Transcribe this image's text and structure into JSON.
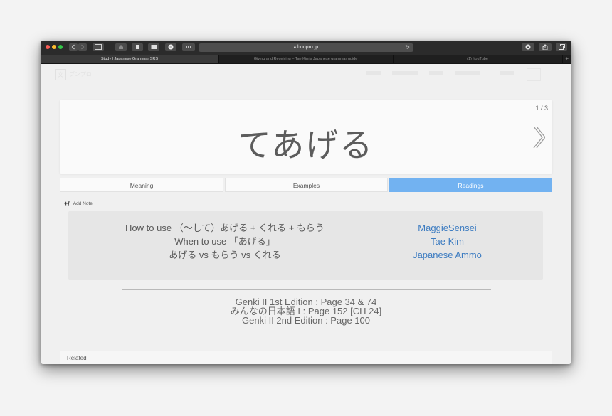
{
  "browser": {
    "url": "bunpro.jp",
    "tabs": [
      {
        "title": "Study | Japanese Grammar SRS",
        "active": true
      },
      {
        "title": "Giving and Receiving – Tae Kim's Japanese grammar guide",
        "active": false
      },
      {
        "title": "(1) YouTube",
        "active": false
      }
    ],
    "icons": [
      "back-icon",
      "forward-icon",
      "sidebar-icon",
      "home-icon",
      "evernote-icon",
      "reader-icon",
      "ublock-icon",
      "more-icon",
      "lock-icon",
      "reload-icon",
      "download-icon",
      "share-icon",
      "tabs-icon",
      "new-tab-icon"
    ]
  },
  "card": {
    "counter": "1 / 3",
    "grammar_point": "てあげる"
  },
  "tabs": [
    {
      "label": "Meaning",
      "active": false
    },
    {
      "label": "Examples",
      "active": false
    },
    {
      "label": "Readings",
      "active": true
    }
  ],
  "add_note": "Add Note",
  "readings": [
    {
      "label": "How to use （〜して）あげる + くれる + もらう",
      "source": "MaggieSensei"
    },
    {
      "label": "When to use 「あげる」",
      "source": "Tae Kim"
    },
    {
      "label": "あげる vs もらう vs くれる",
      "source": "Japanese Ammo"
    }
  ],
  "books": [
    "Genki II 1st Edition : Page 34 & 74",
    "みんなの日本語 I : Page 152 [CH 24]",
    "Genki II 2nd Edition : Page 100"
  ],
  "related_label": "Related",
  "colors": {
    "active_tab": "#72b2f1",
    "link": "#3d7cc1"
  }
}
